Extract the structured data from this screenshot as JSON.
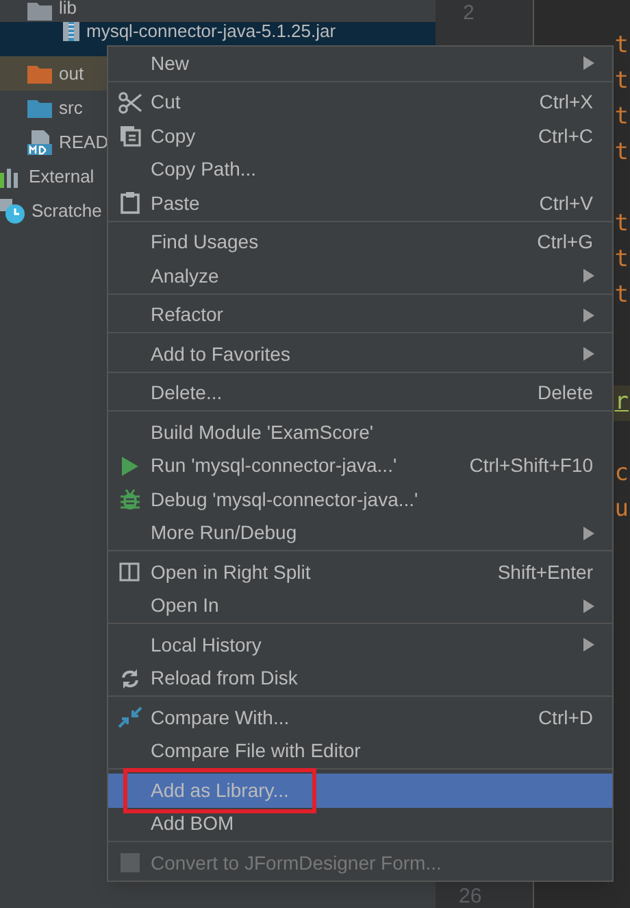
{
  "project_tree": [
    {
      "children": [
        {
          "label": "lib",
          "kind": "folder-gray",
          "selected": false,
          "excluded": false,
          "children": [
            {
              "label": "mysql-connector-java-5.1.25.jar",
              "kind": "jar",
              "selected": true,
              "excluded": false
            }
          ]
        },
        {
          "label": "out",
          "kind": "folder-orange",
          "selected": false,
          "excluded": true
        },
        {
          "label": "src",
          "kind": "folder-blue",
          "selected": false,
          "excluded": false
        },
        {
          "label": "READ",
          "kind": "markdown",
          "selected": false,
          "excluded": false
        }
      ]
    },
    {
      "label": "External",
      "kind": "libraries",
      "selected": false,
      "excluded": false
    },
    {
      "label": "Scratche",
      "kind": "scratches",
      "selected": false,
      "excluded": false
    }
  ],
  "gutter": {
    "top_line": "2",
    "bottom_line": "26"
  },
  "editor_lines": [
    {
      "kind": "code",
      "text": "t"
    },
    {
      "kind": "code",
      "text": "t"
    },
    {
      "kind": "code",
      "text": "t"
    },
    {
      "kind": "code",
      "text": "t"
    },
    {
      "kind": "blank"
    },
    {
      "kind": "code",
      "text": "t"
    },
    {
      "kind": "code",
      "text": "t"
    },
    {
      "kind": "code",
      "text": "t"
    },
    {
      "kind": "blank"
    },
    {
      "kind": "blank"
    },
    {
      "kind": "highlight",
      "text": "r"
    },
    {
      "kind": "blank"
    },
    {
      "kind": "code",
      "text": "c"
    },
    {
      "kind": "code",
      "text": "u"
    }
  ],
  "context_menu": {
    "sections": [
      {
        "items": [
          {
            "label": "New",
            "submenu": true,
            "selected": false,
            "disabled": false,
            "boxed": false
          }
        ]
      },
      {
        "items": [
          {
            "label": "Cut",
            "shortcut": "Ctrl+X",
            "submenu": false,
            "selected": false,
            "disabled": false,
            "boxed": false
          },
          {
            "label": "Copy",
            "shortcut": "Ctrl+C",
            "submenu": false,
            "selected": false,
            "disabled": false,
            "boxed": false
          },
          {
            "label": "Copy Path...",
            "submenu": false,
            "selected": false,
            "disabled": false,
            "boxed": false
          },
          {
            "label": "Paste",
            "shortcut": "Ctrl+V",
            "submenu": false,
            "selected": false,
            "disabled": false,
            "boxed": false
          }
        ]
      },
      {
        "items": [
          {
            "label": "Find Usages",
            "shortcut": "Ctrl+G",
            "submenu": false,
            "selected": false,
            "disabled": false,
            "boxed": false
          },
          {
            "label": "Analyze",
            "submenu": true,
            "selected": false,
            "disabled": false,
            "boxed": false
          }
        ]
      },
      {
        "items": [
          {
            "label": "Refactor",
            "submenu": true,
            "selected": false,
            "disabled": false,
            "boxed": false
          }
        ]
      },
      {
        "items": [
          {
            "label": "Add to Favorites",
            "submenu": true,
            "selected": false,
            "disabled": false,
            "boxed": false
          }
        ]
      },
      {
        "items": [
          {
            "label": "Delete...",
            "shortcut": "Delete",
            "submenu": false,
            "selected": false,
            "disabled": false,
            "boxed": false
          }
        ]
      },
      {
        "items": [
          {
            "label": "Build Module 'ExamScore'",
            "submenu": false,
            "selected": false,
            "disabled": false,
            "boxed": false
          },
          {
            "label": "Run 'mysql-connector-java...'",
            "shortcut": "Ctrl+Shift+F10",
            "submenu": false,
            "selected": false,
            "disabled": false,
            "boxed": false
          },
          {
            "label": "Debug 'mysql-connector-java...'",
            "submenu": false,
            "selected": false,
            "disabled": false,
            "boxed": false
          },
          {
            "label": "More Run/Debug",
            "submenu": true,
            "selected": false,
            "disabled": false,
            "boxed": false
          }
        ]
      },
      {
        "items": [
          {
            "label": "Open in Right Split",
            "shortcut": "Shift+Enter",
            "submenu": false,
            "selected": false,
            "disabled": false,
            "boxed": false
          },
          {
            "label": "Open In",
            "submenu": true,
            "selected": false,
            "disabled": false,
            "boxed": false
          }
        ]
      },
      {
        "items": [
          {
            "label": "Local History",
            "submenu": true,
            "selected": false,
            "disabled": false,
            "boxed": false
          },
          {
            "label": "Reload from Disk",
            "submenu": false,
            "selected": false,
            "disabled": false,
            "boxed": false
          }
        ]
      },
      {
        "items": [
          {
            "label": "Compare With...",
            "shortcut": "Ctrl+D",
            "submenu": false,
            "selected": false,
            "disabled": false,
            "boxed": false
          },
          {
            "label": "Compare File with Editor",
            "submenu": false,
            "selected": false,
            "disabled": false,
            "boxed": false
          }
        ]
      },
      {
        "items": [
          {
            "label": "Add as Library...",
            "submenu": false,
            "selected": true,
            "disabled": false,
            "boxed": true
          },
          {
            "label": "Add BOM",
            "submenu": false,
            "selected": false,
            "disabled": false,
            "boxed": false
          }
        ]
      },
      {
        "items": [
          {
            "label": "Convert to JFormDesigner Form...",
            "submenu": false,
            "selected": false,
            "disabled": true,
            "boxed": false
          }
        ]
      }
    ]
  }
}
